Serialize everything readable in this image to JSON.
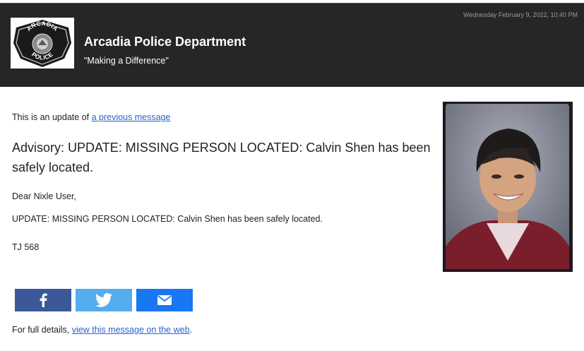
{
  "header": {
    "date": "Wednesday February 9, 2022, 10:40 PM",
    "org_name": "Arcadia Police Department",
    "tagline": "\"Making a Difference\"",
    "logo": {
      "top_text": "ARCADIA",
      "bottom_text": "POLICE"
    }
  },
  "message": {
    "update_prefix": "This is an update of ",
    "update_link": "a previous message",
    "headline": "Advisory: UPDATE: MISSING PERSON LOCATED: Calvin Shen has been safely located.",
    "greeting": "Dear Nixle User,",
    "body": "UPDATE: MISSING PERSON LOCATED: Calvin Shen has been safely located.",
    "signature": "TJ 568"
  },
  "share": [
    {
      "name": "facebook",
      "icon": "facebook-icon",
      "color": "#3b5998"
    },
    {
      "name": "twitter",
      "icon": "twitter-icon",
      "color": "#55acee"
    },
    {
      "name": "email",
      "icon": "mail-icon",
      "color": "#1877f2"
    }
  ],
  "footer": {
    "prefix": "For full details, ",
    "link": "view this message on the web",
    "suffix": "."
  },
  "colors": {
    "header_bg": "#262626",
    "link": "#2a62c9"
  }
}
